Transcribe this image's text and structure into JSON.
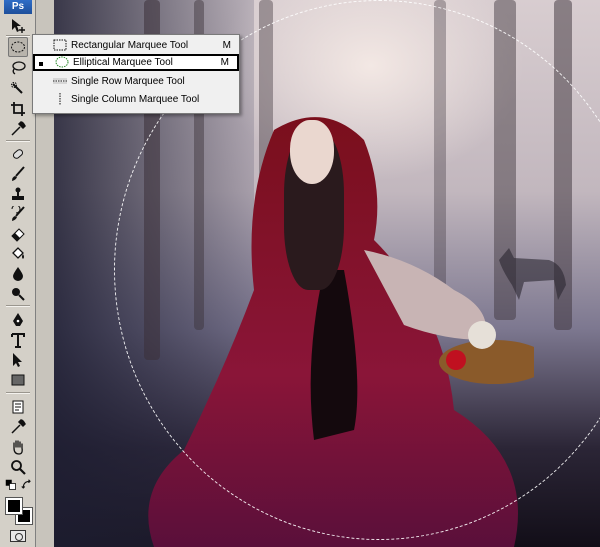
{
  "app": {
    "logo": "Ps"
  },
  "toolbar": {
    "tools": [
      {
        "name": "move-tool",
        "icon": "move-icon"
      },
      {
        "name": "elliptical-marquee-tool",
        "icon": "ellipse-marquee-icon",
        "active": true
      },
      {
        "name": "lasso-tool",
        "icon": "lasso-icon"
      },
      {
        "name": "quick-selection-tool",
        "icon": "quick-selection-icon"
      },
      {
        "name": "crop-tool",
        "icon": "crop-icon"
      },
      {
        "name": "eyedropper-tool",
        "icon": "eyedropper-icon"
      },
      {
        "name": "spot-healing-tool",
        "icon": "healing-icon"
      },
      {
        "name": "brush-tool",
        "icon": "brush-icon"
      },
      {
        "name": "clone-stamp-tool",
        "icon": "stamp-icon"
      },
      {
        "name": "history-brush-tool",
        "icon": "history-brush-icon"
      },
      {
        "name": "eraser-tool",
        "icon": "eraser-icon"
      },
      {
        "name": "paint-bucket-tool",
        "icon": "bucket-icon"
      },
      {
        "name": "blur-tool",
        "icon": "drop-icon"
      },
      {
        "name": "dodge-tool",
        "icon": "dodge-icon"
      },
      {
        "name": "pen-tool",
        "icon": "pen-icon"
      },
      {
        "name": "type-tool",
        "icon": "type-icon"
      },
      {
        "name": "path-selection-tool",
        "icon": "arrow-icon"
      },
      {
        "name": "rectangle-tool",
        "icon": "rectangle-icon"
      },
      {
        "name": "notes-tool",
        "icon": "notes-icon"
      },
      {
        "name": "eyedropper-tool-2",
        "icon": "eyedropper-icon"
      },
      {
        "name": "hand-tool",
        "icon": "hand-icon"
      },
      {
        "name": "zoom-tool",
        "icon": "zoom-icon"
      }
    ],
    "foreground_color": "#000000",
    "background_color": "#000000"
  },
  "flyout": {
    "items": [
      {
        "label": "Rectangular Marquee Tool",
        "shortcut": "M",
        "selected": false
      },
      {
        "label": "Elliptical Marquee Tool",
        "shortcut": "M",
        "selected": true
      },
      {
        "label": "Single Row Marquee Tool",
        "shortcut": "",
        "selected": false
      },
      {
        "label": "Single Column Marquee Tool",
        "shortcut": "",
        "selected": false
      }
    ]
  }
}
